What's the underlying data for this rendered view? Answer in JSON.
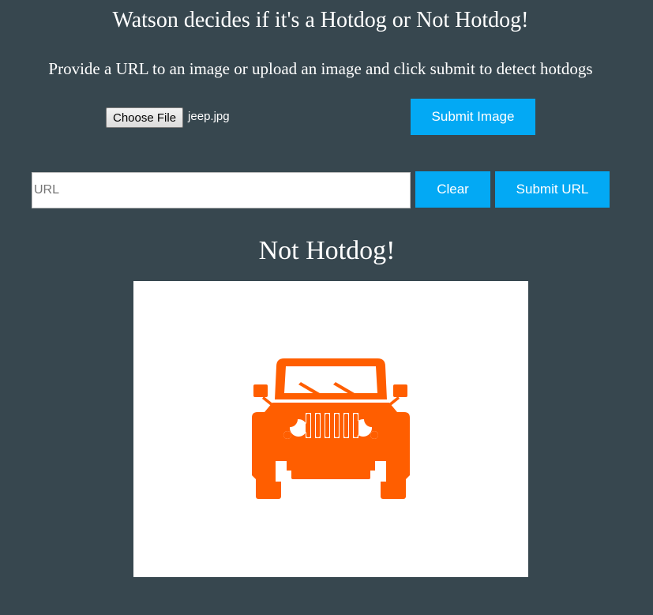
{
  "header": {
    "title": "Watson decides if it's a Hotdog or Not Hotdog!",
    "instructions": "Provide a URL to an image or upload an image and click submit to detect hotdogs"
  },
  "upload": {
    "choose_file_label": "Choose File",
    "file_name": "jeep.jpg",
    "submit_image_label": "Submit Image"
  },
  "url_form": {
    "placeholder": "URL",
    "value": "",
    "clear_label": "Clear",
    "submit_url_label": "Submit URL"
  },
  "result": {
    "label": "Not Hotdog!",
    "image_icon": "jeep-icon"
  },
  "colors": {
    "background": "#37474f",
    "button": "#03a9f4",
    "jeep": "#ff5e00"
  }
}
